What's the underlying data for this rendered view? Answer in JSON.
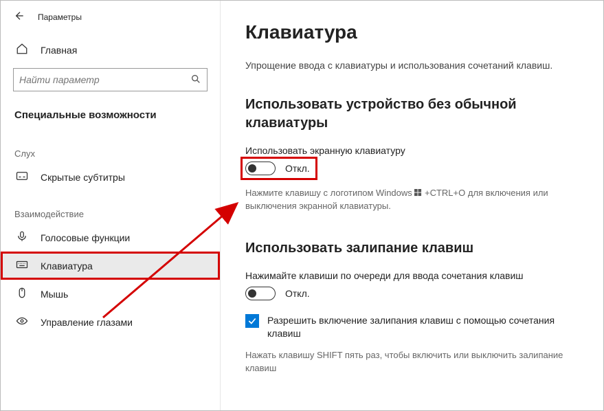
{
  "titlebar": {
    "label": "Параметры"
  },
  "home": {
    "label": "Главная"
  },
  "search": {
    "placeholder": "Найти параметр"
  },
  "section_title": "Специальные возможности",
  "groups": {
    "hearing": "Слух",
    "interaction": "Взаимодействие"
  },
  "nav": {
    "captions": "Скрытые субтитры",
    "speech": "Голосовые функции",
    "keyboard": "Клавиатура",
    "mouse": "Мышь",
    "eye": "Управление глазами"
  },
  "main": {
    "title": "Клавиатура",
    "desc": "Упрощение ввода с клавиатуры и использования сочетаний клавиш.",
    "osk": {
      "heading": "Использовать устройство без обычной клавиатуры",
      "label": "Использовать экранную клавиатуру",
      "state": "Откл.",
      "hint_pre": "Нажмите клавишу с логотипом Windows ",
      "hint_post": " +CTRL+O для включения или выключения экранной клавиатуры."
    },
    "sticky": {
      "heading": "Использовать залипание клавиш",
      "label": "Нажимайте клавиши по очереди для ввода сочетания клавиш",
      "state": "Откл.",
      "checkbox": "Разрешить включение залипания клавиш с помощью сочетания клавиш",
      "hint": "Нажать клавишу SHIFT пять раз, чтобы включить или выключить залипание клавиш"
    }
  }
}
